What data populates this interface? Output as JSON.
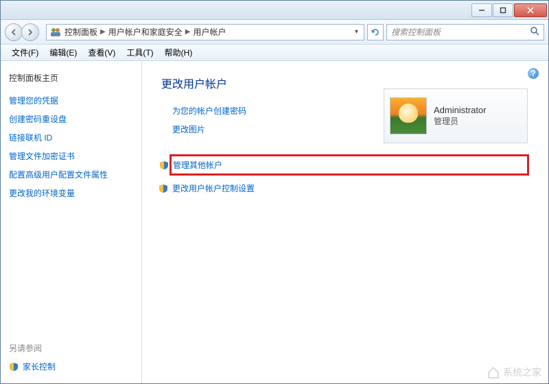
{
  "window": {
    "minimize": "–",
    "maximize": "□",
    "close": "×"
  },
  "breadcrumb": {
    "parts": [
      "控制面板",
      "用户帐户和家庭安全",
      "用户帐户"
    ]
  },
  "search": {
    "placeholder": "搜索控制面板"
  },
  "menubar": {
    "file": "文件(F)",
    "edit": "编辑(E)",
    "view": "查看(V)",
    "tools": "工具(T)",
    "help": "帮助(H)"
  },
  "sidebar": {
    "title": "控制面板主页",
    "links": [
      "管理您的凭据",
      "创建密码重设盘",
      "链接联机 ID",
      "管理文件加密证书",
      "配置高级用户配置文件属性",
      "更改我的环境变量"
    ],
    "see_also": "另请参阅",
    "parental": "家长控制"
  },
  "main": {
    "title": "更改用户帐户",
    "create_password": "为您的帐户创建密码",
    "change_picture": "更改图片",
    "manage_other": "管理其他帐户",
    "change_uac": "更改用户帐户控制设置"
  },
  "account": {
    "name": "Administrator",
    "role": "管理员"
  },
  "watermark": "系统之家"
}
